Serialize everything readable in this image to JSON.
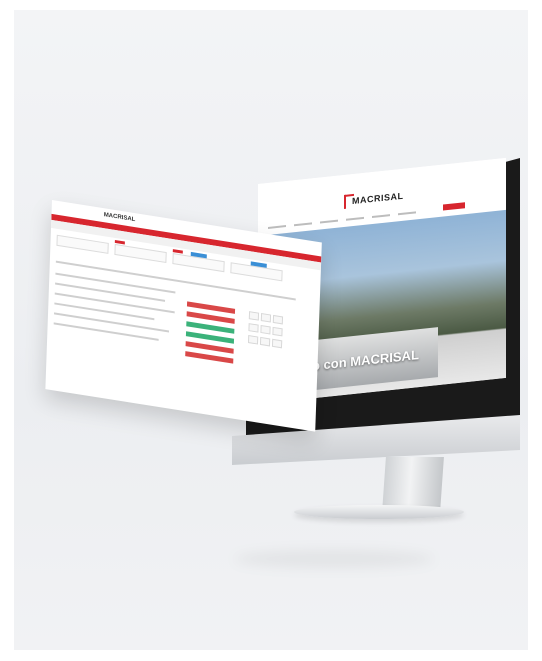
{
  "website": {
    "logo_text": "MACRISAL",
    "hero_title": "Viviendo con MACRISAL"
  },
  "dashboard": {
    "logo_text": "MACRISAL"
  },
  "colors": {
    "brand_red": "#d7262e",
    "stat_green": "#3bb27a",
    "stat_red": "#d94848",
    "accent_blue": "#3a8fd6"
  }
}
